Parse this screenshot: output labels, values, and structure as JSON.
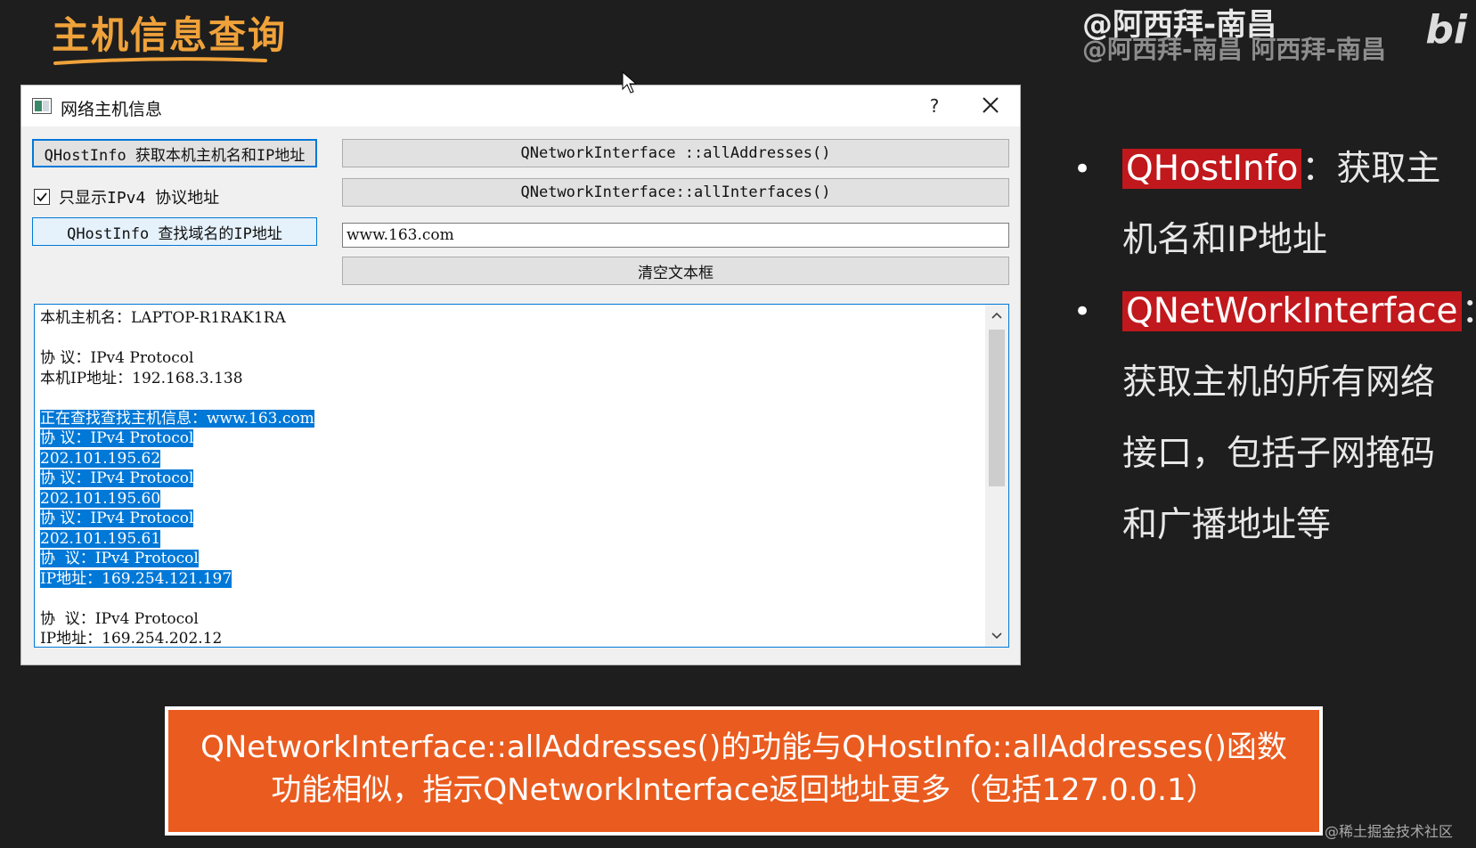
{
  "slide": {
    "title": "主机信息查询",
    "watermark_line1": "@阿西拜-南昌",
    "watermark_line2": "@阿西拜-南昌 阿西拜-南昌",
    "watermark_logo": "bi",
    "site_watermark": "@稀土掘金技术社区"
  },
  "dialog": {
    "title": "网络主机信息",
    "help": "?",
    "buttons": {
      "get_local_host": "QHostInfo 获取本机主机名和IP地址",
      "all_addresses": "QNetworkInterface ::allAddresses()",
      "all_interfaces": "QNetworkInterface::allInterfaces()",
      "lookup_domain": "QHostInfo 查找域名的IP地址",
      "clear_text": "清空文本框"
    },
    "checkbox": {
      "label": "只显示IPv4 协议地址",
      "checked": true
    },
    "domain_input": {
      "value": "www.163.com"
    },
    "output_lines": [
      {
        "text": "本机主机名：LAPTOP-R1RAK1RA",
        "selected": false
      },
      {
        "text": "",
        "selected": false
      },
      {
        "text": "协 议：IPv4 Protocol",
        "selected": false
      },
      {
        "text": "本机IP地址：192.168.3.138",
        "selected": false
      },
      {
        "text": "",
        "selected": false
      },
      {
        "text": "正在查找查找主机信息：www.163.com",
        "selected": true
      },
      {
        "text": "协 议：IPv4 Protocol",
        "selected": true
      },
      {
        "text": "202.101.195.62",
        "selected": true
      },
      {
        "text": "协 议：IPv4 Protocol",
        "selected": true
      },
      {
        "text": "202.101.195.60",
        "selected": true
      },
      {
        "text": "协 议：IPv4 Protocol",
        "selected": true
      },
      {
        "text": "202.101.195.61",
        "selected": true
      },
      {
        "text": "协  议：IPv4 Protocol",
        "selected": true
      },
      {
        "text": "IP地址：169.254.121.197",
        "selected": true
      },
      {
        "text": "",
        "selected": false
      },
      {
        "text": "协  议：IPv4 Protocol",
        "selected": false
      },
      {
        "text": "IP地址：169.254.202.12",
        "selected": false
      }
    ]
  },
  "bullets": [
    {
      "highlight": "QHostInfo",
      "text": "：获取主机名和IP地址"
    },
    {
      "highlight": "QNetWorkInterface",
      "text": "：获取主机的所有网络接口，包括子网掩码和广播地址等"
    }
  ],
  "callout": {
    "line1": "QNetworkInterface::allAddresses()的功能与QHostInfo::allAddresses()函数",
    "line2": "功能相似，指示QNetworkInterface返回地址更多（包括127.0.0.1）"
  },
  "colors": {
    "accent_title": "#f0a23a",
    "highlight_red": "#c0181c",
    "callout_orange": "#ea5b1f",
    "selection_blue": "#0078d7"
  }
}
